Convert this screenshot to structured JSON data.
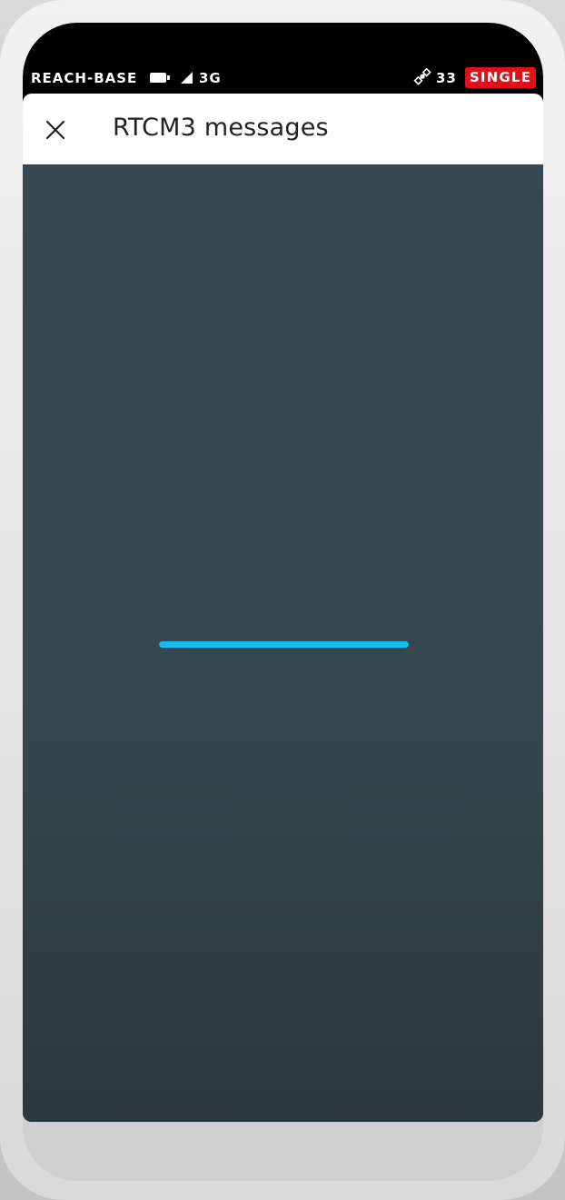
{
  "status_bar": {
    "device_name": "REACH-BASE",
    "battery_icon": "battery-icon",
    "signal_icon": "cell-signal-icon",
    "network": "3G",
    "satellite_icon": "satellite-icon",
    "satellite_count": "33",
    "solution_status": "SINGLE",
    "solution_color": "#e0101a"
  },
  "app_bar": {
    "close_icon": "close-icon",
    "title": "RTCM3 messages"
  },
  "loading": {
    "indicator": "linear-progress-bar",
    "progress": 1.0,
    "color": "#13bdf0"
  },
  "colors": {
    "content_background": "#37474f",
    "app_bar_background": "#ffffff",
    "status_bar_background": "#000000"
  }
}
